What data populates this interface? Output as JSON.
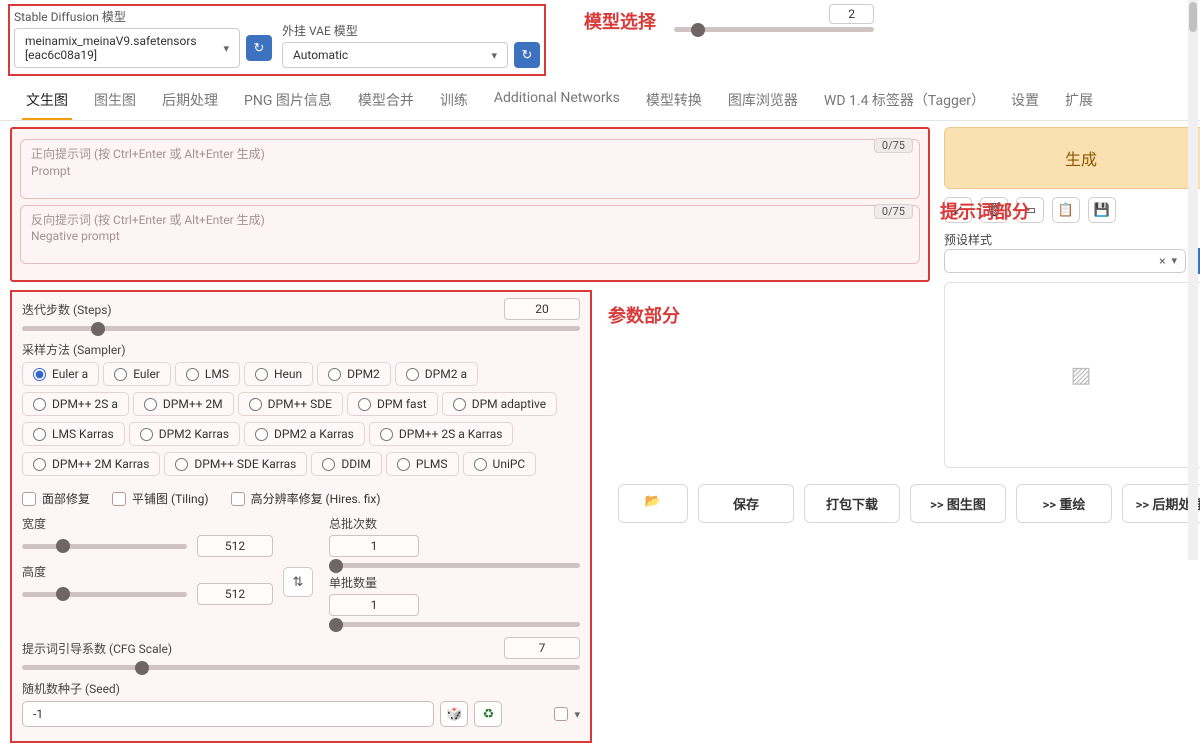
{
  "top": {
    "sd_label": "Stable Diffusion 模型",
    "sd_value": "meinamix_meinaV9.safetensors [eac6c08a19]",
    "vae_label": "外挂 VAE 模型",
    "vae_value": "Automatic",
    "top_num": "2"
  },
  "annots": {
    "model": "模型选择",
    "prompt": "提示词部分",
    "params": "参数部分"
  },
  "tabs": [
    "文生图",
    "图生图",
    "后期处理",
    "PNG 图片信息",
    "模型合并",
    "训练",
    "Additional Networks",
    "模型转换",
    "图库浏览器",
    "WD 1.4 标签器（Tagger）",
    "设置",
    "扩展"
  ],
  "active_tab": 0,
  "prompt": {
    "pos_hint1": "正向提示词 (按 Ctrl+Enter 或 Alt+Enter 生成)",
    "pos_hint2": "Prompt",
    "pos_counter": "0/75",
    "neg_hint1": "反向提示词 (按 Ctrl+Enter 或 Alt+Enter 生成)",
    "neg_hint2": "Negative prompt",
    "neg_counter": "0/75"
  },
  "params": {
    "steps_label": "迭代步数 (Steps)",
    "steps_value": "20",
    "sampler_label": "采样方法 (Sampler)",
    "samplers": [
      "Euler a",
      "Euler",
      "LMS",
      "Heun",
      "DPM2",
      "DPM2 a",
      "DPM++ 2S a",
      "DPM++ 2M",
      "DPM++ SDE",
      "DPM fast",
      "DPM adaptive",
      "LMS Karras",
      "DPM2 Karras",
      "DPM2 a Karras",
      "DPM++ 2S a Karras",
      "DPM++ 2M Karras",
      "DPM++ SDE Karras",
      "DDIM",
      "PLMS",
      "UniPC"
    ],
    "sampler_selected": 0,
    "checks": {
      "face": "面部修复",
      "tiling": "平铺图 (Tiling)",
      "hires": "高分辨率修复 (Hires. fix)"
    },
    "width_label": "宽度",
    "width_value": "512",
    "height_label": "高度",
    "height_value": "512",
    "batch_count_label": "总批次数",
    "batch_count_value": "1",
    "batch_size_label": "单批数量",
    "batch_size_value": "1",
    "cfg_label": "提示词引导系数 (CFG Scale)",
    "cfg_value": "7",
    "seed_label": "随机数种子 (Seed)",
    "seed_value": "-1"
  },
  "right": {
    "generate": "生成",
    "preset_label": "预设样式",
    "actions_folder": "📂",
    "actions": [
      "保存",
      "打包下载",
      ">> 图生图",
      ">> 重绘",
      ">> 后期处理"
    ]
  }
}
